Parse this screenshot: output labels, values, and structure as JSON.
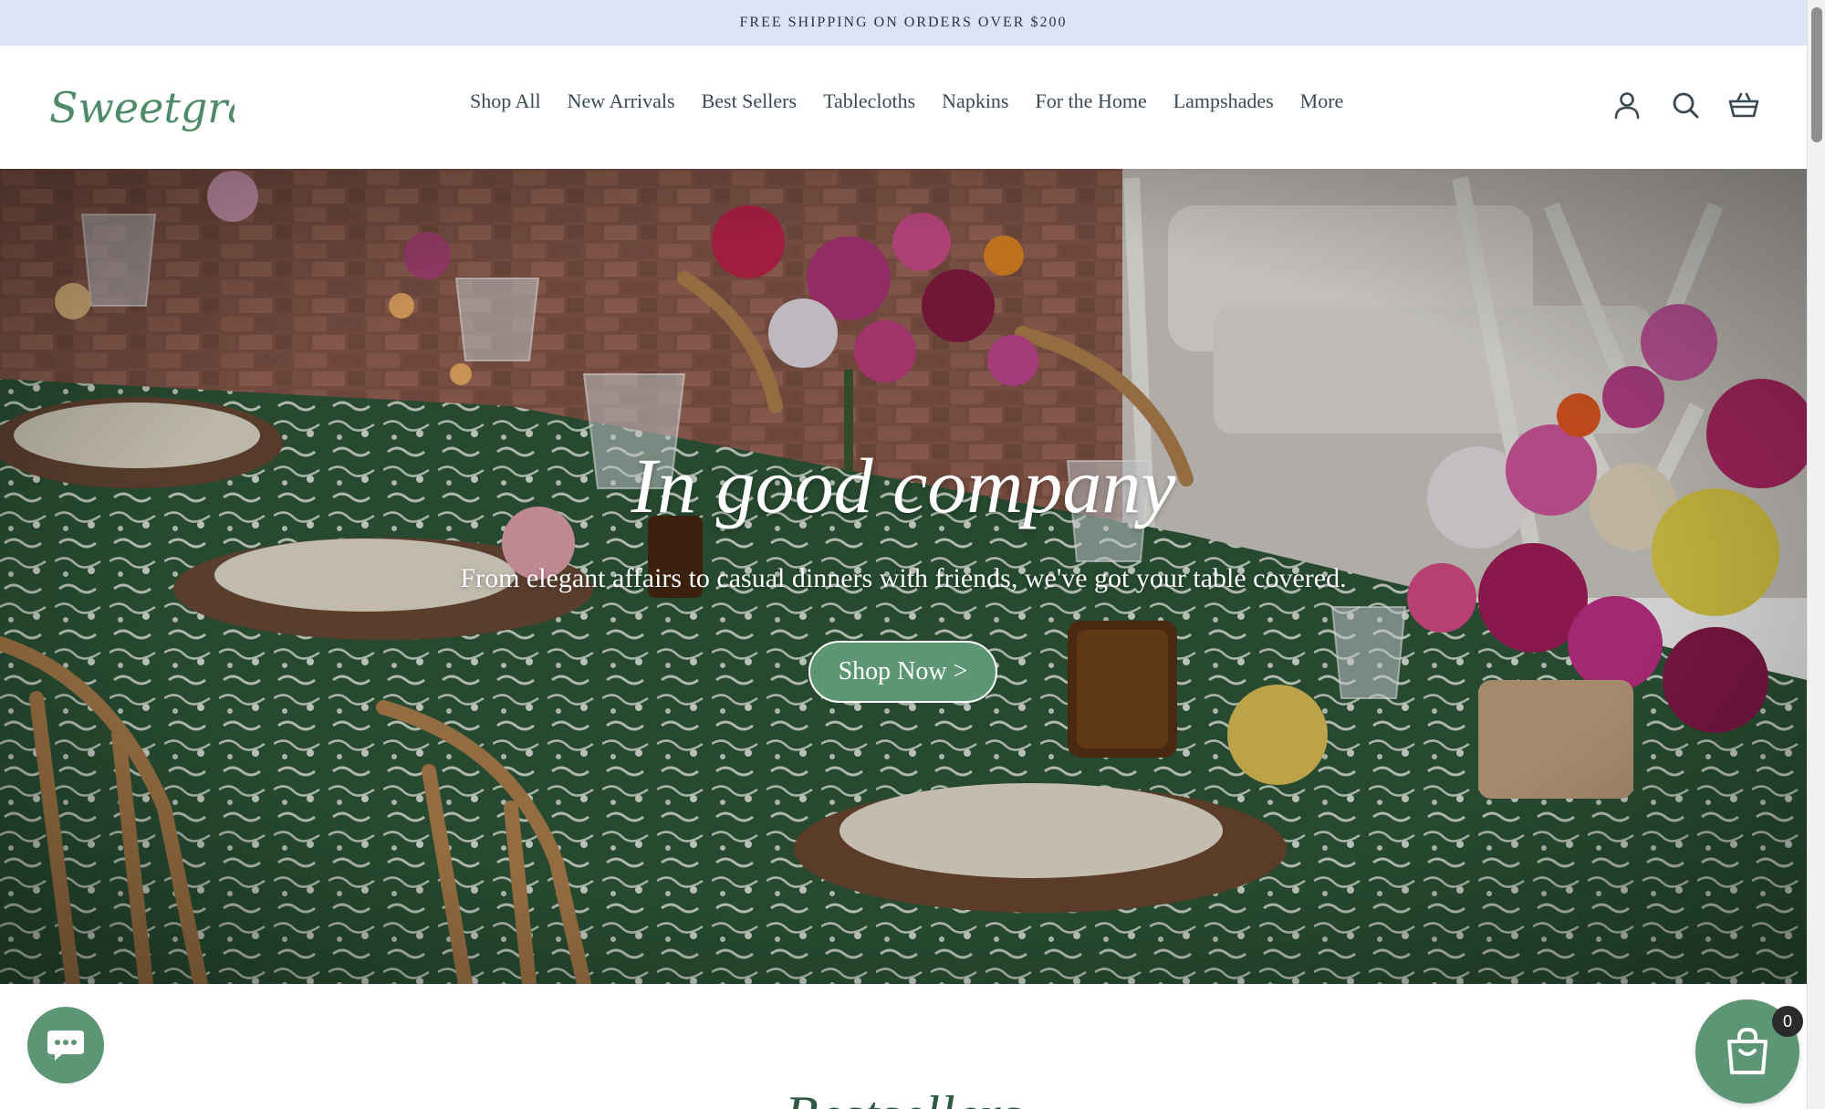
{
  "announcement": {
    "text": "FREE SHIPPING ON ORDERS OVER $200"
  },
  "brand": {
    "logo_text": "Sweetgrass"
  },
  "nav": {
    "items": [
      {
        "label": "Shop All"
      },
      {
        "label": "New Arrivals"
      },
      {
        "label": "Best Sellers"
      },
      {
        "label": "Tablecloths"
      },
      {
        "label": "Napkins"
      },
      {
        "label": "For the Home"
      },
      {
        "label": "Lampshades"
      },
      {
        "label": "More"
      }
    ]
  },
  "header_icons": [
    "account-icon",
    "search-icon",
    "basket-icon"
  ],
  "hero": {
    "title": "In good company",
    "subtitle": "From elegant affairs to casual dinners with friends, we've got your table covered.",
    "cta_label": "Shop Now >"
  },
  "section": {
    "title": "Bestsellers"
  },
  "cart": {
    "count": "0"
  },
  "colors": {
    "announcement_bg": "#dbe3f5",
    "accent_green": "#5d9674",
    "text_dark": "#3b4a52"
  }
}
